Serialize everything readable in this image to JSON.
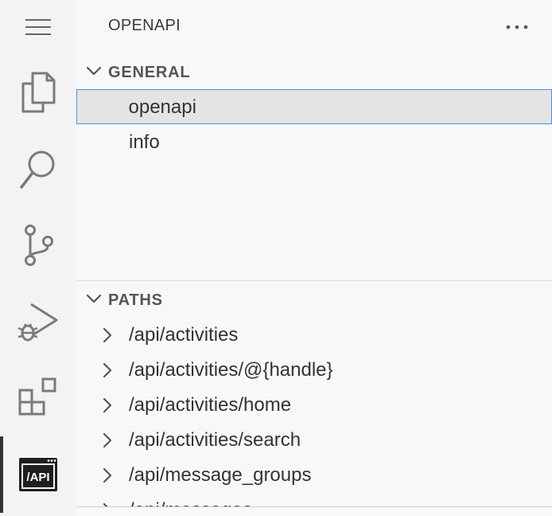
{
  "sidebar": {
    "title": "OPENAPI"
  },
  "activity_bar": {
    "items": [
      {
        "icon": "files-icon"
      },
      {
        "icon": "search-icon"
      },
      {
        "icon": "source-control-icon"
      },
      {
        "icon": "run-debug-icon"
      },
      {
        "icon": "extensions-icon"
      },
      {
        "icon": "openapi-icon",
        "label": "/API",
        "active": true
      }
    ]
  },
  "general": {
    "title": "GENERAL",
    "items": [
      {
        "label": "openapi",
        "selected": true
      },
      {
        "label": "info"
      }
    ]
  },
  "paths": {
    "title": "PATHS",
    "items": [
      {
        "label": "/api/activities"
      },
      {
        "label": "/api/activities/@{handle}"
      },
      {
        "label": "/api/activities/home"
      },
      {
        "label": "/api/activities/search"
      },
      {
        "label": "/api/message_groups"
      },
      {
        "label": "/api/messages"
      }
    ]
  },
  "colors": {
    "selection_border": "#4a8fe0",
    "selection_bg": "#e4e4e4",
    "activity_bar_bg": "#f3f3f3",
    "sidebar_bg": "#f8f8f8"
  }
}
